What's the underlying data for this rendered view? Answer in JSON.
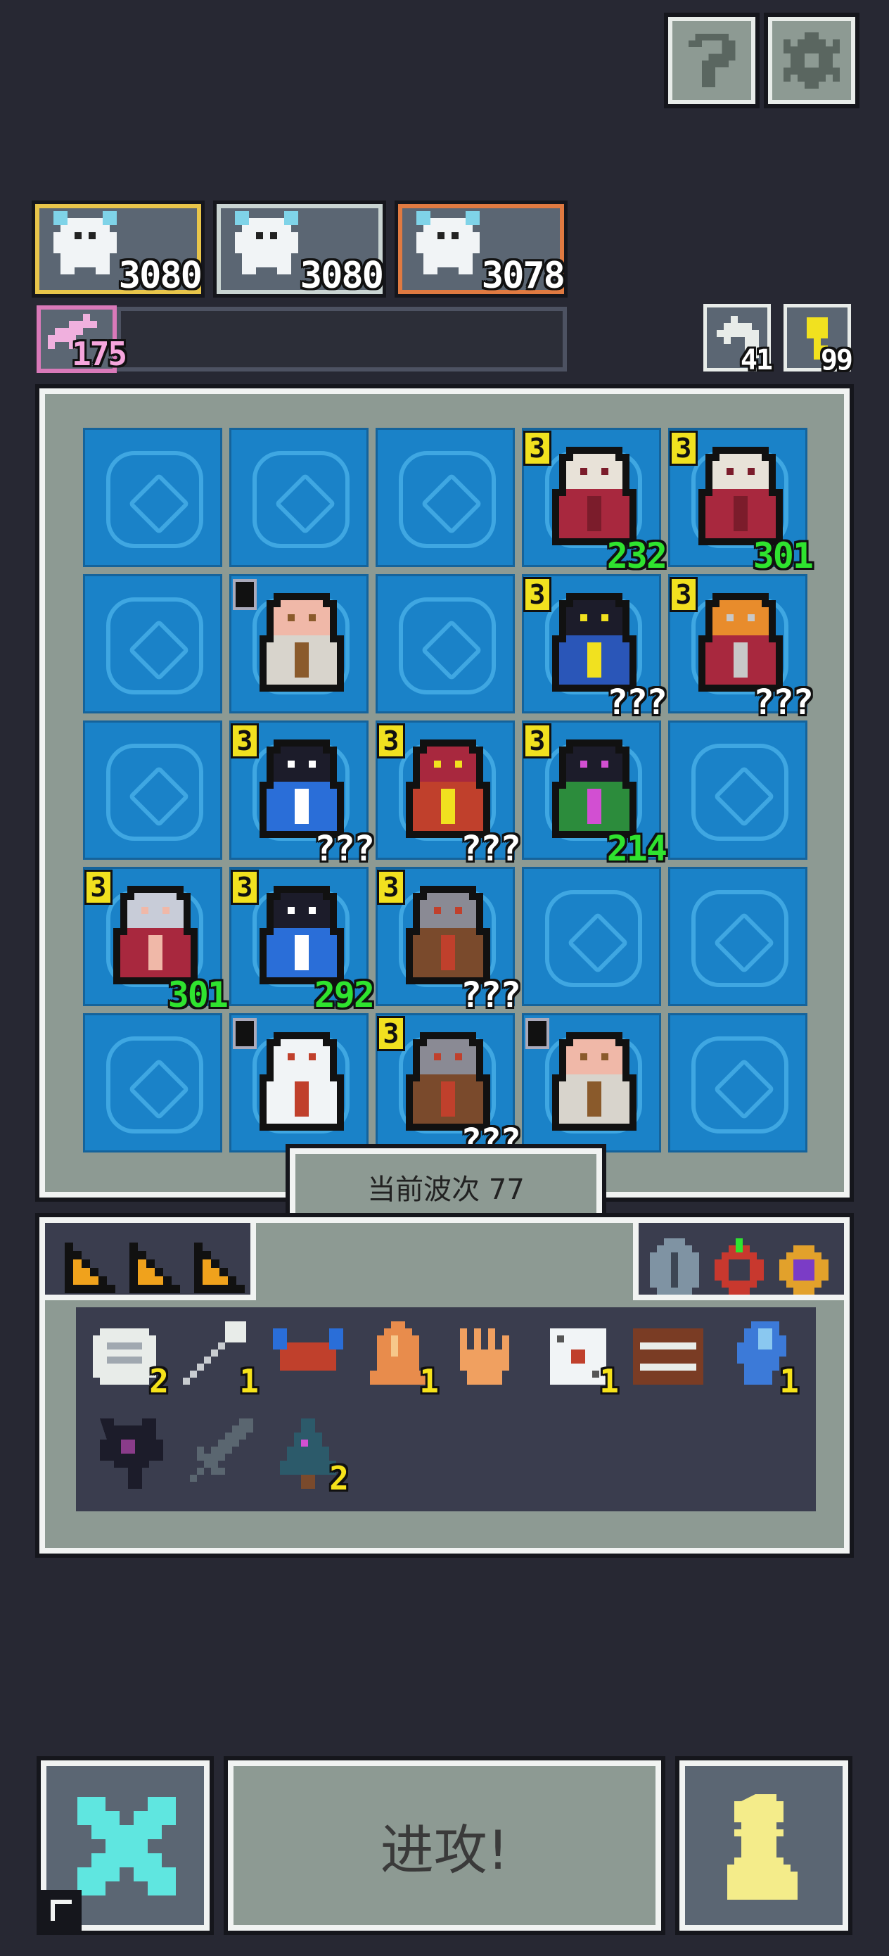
{
  "top_buttons": [
    {
      "name": "help-button",
      "icon": "question-mark-icon",
      "glyph": "?"
    },
    {
      "name": "settings-button",
      "icon": "gear-icon",
      "glyph": "⚙"
    }
  ],
  "hero_cards": [
    {
      "value": "3080",
      "border": "#e8c54a"
    },
    {
      "value": "3080",
      "border": "#c9d4d2"
    },
    {
      "value": "3078",
      "border": "#e07a41"
    }
  ],
  "progress": {
    "value": "175",
    "icon": "unicorn-icon"
  },
  "resources": [
    {
      "icon": "refresh-arrow-icon",
      "value": "41"
    },
    {
      "icon": "key-icon",
      "value": "99"
    }
  ],
  "board": {
    "cells": [
      [
        null,
        null,
        null,
        {
          "unit": "red-hooded-monk",
          "stars": "3",
          "hp": "232",
          "hp_color": "green"
        },
        {
          "unit": "red-hooded-monk",
          "stars": "3",
          "hp": "301",
          "hp_color": "green"
        }
      ],
      [
        null,
        {
          "unit": "old-farmer",
          "stars": "",
          "hp": "",
          "hp_color": "white"
        },
        null,
        {
          "unit": "dark-haired-mage",
          "stars": "3",
          "hp": "???",
          "hp_color": "white"
        },
        {
          "unit": "flame-bearded-dwarf",
          "stars": "3",
          "hp": "???",
          "hp_color": "white"
        }
      ],
      [
        null,
        {
          "unit": "blue-shadow-beast",
          "stars": "3",
          "hp": "???",
          "hp_color": "white"
        },
        {
          "unit": "red-armored-knight",
          "stars": "3",
          "hp": "???",
          "hp_color": "white"
        },
        {
          "unit": "green-witch",
          "stars": "3",
          "hp": "214",
          "hp_color": "green"
        },
        null
      ],
      [
        {
          "unit": "silver-haired-girl",
          "stars": "3",
          "hp": "301",
          "hp_color": "green"
        },
        {
          "unit": "blue-shadow-beast",
          "stars": "3",
          "hp": "292",
          "hp_color": "green"
        },
        {
          "unit": "iron-shield-guard",
          "stars": "3",
          "hp": "???",
          "hp_color": "white"
        },
        null,
        null
      ],
      [
        null,
        {
          "unit": "white-yeti",
          "stars": "",
          "hp": "",
          "hp_color": "white"
        },
        {
          "unit": "iron-shield-guard",
          "stars": "3",
          "hp": "???",
          "hp_color": "white"
        },
        {
          "unit": "old-farmer",
          "stars": "",
          "hp": "",
          "hp_color": "white"
        },
        null
      ]
    ]
  },
  "wave_label": "当前波次 77",
  "consumables": [
    "cheese-wedge-icon",
    "cheese-wedge-icon",
    "cheese-wedge-icon"
  ],
  "trinkets": [
    "beetle-icon",
    "red-ring-icon",
    "purple-ring-icon"
  ],
  "items": [
    {
      "icon": "scroll-icon",
      "count": "2"
    },
    {
      "icon": "wand-icon",
      "count": "1"
    },
    {
      "icon": "crab-icon",
      "count": ""
    },
    {
      "icon": "bell-icon",
      "count": "1"
    },
    {
      "icon": "claw-icon",
      "count": ""
    },
    {
      "icon": "dice-icon",
      "count": "1"
    },
    {
      "icon": "abacus-icon",
      "count": ""
    },
    {
      "icon": "crystal-icon",
      "count": "1"
    },
    {
      "icon": "shadow-flower-icon",
      "count": ""
    },
    {
      "icon": "sword-icon",
      "count": ""
    },
    {
      "icon": "pine-tree-icon",
      "count": "2"
    }
  ],
  "bottom": {
    "cancel_icon": "cross-icon",
    "attack_label": "进攻!",
    "pawn_icon": "pawn-icon"
  }
}
